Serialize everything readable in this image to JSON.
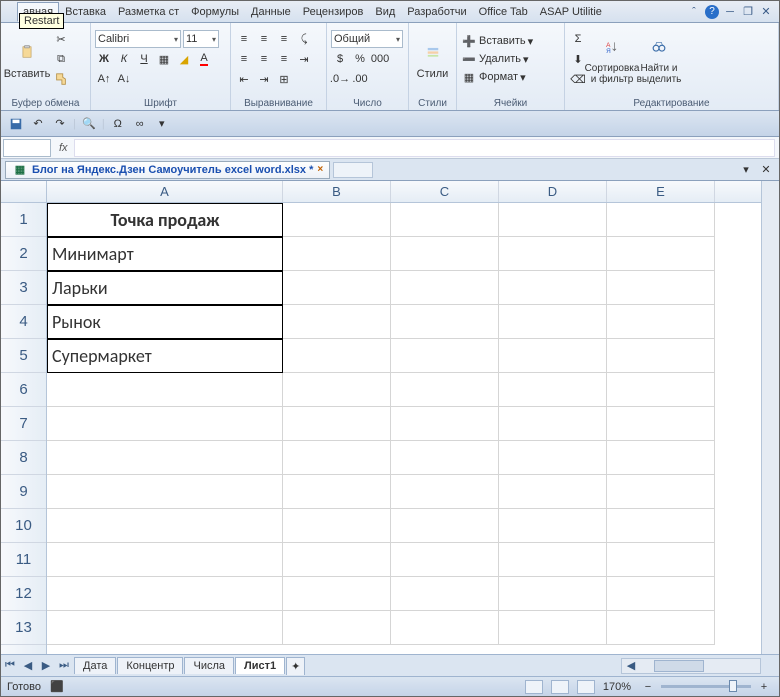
{
  "tooltip": "Restart",
  "tabs": [
    "авная",
    "Вставка",
    "Разметка ст",
    "Формулы",
    "Данные",
    "Рецензиров",
    "Вид",
    "Разработчи",
    "Office Tab",
    "ASAP Utilitie"
  ],
  "ribbon": {
    "paste": "Вставить",
    "clipboard": "Буфер обмена",
    "font": {
      "name": "Calibri",
      "size": "11",
      "group": "Шрифт"
    },
    "align": "Выравнивание",
    "number": {
      "format": "Общий",
      "group": "Число"
    },
    "styles": {
      "btn": "Стили",
      "group": "Стили"
    },
    "cells": {
      "insert": "Вставить",
      "delete": "Удалить",
      "format": "Формат",
      "group": "Ячейки"
    },
    "edit": {
      "sort": "Сортировка\nи фильтр",
      "find": "Найти и\nвыделить",
      "group": "Редактирование"
    }
  },
  "doc": {
    "title": "Блог на Яндекс.Дзен Самоучитель excel word.xlsx *"
  },
  "columns": [
    "A",
    "B",
    "C",
    "D",
    "E"
  ],
  "data": {
    "A1": "Точка продаж",
    "A2": "Минимарт",
    "A3": "Ларьки",
    "A4": "Рынок",
    "A5": "Супермаркет"
  },
  "sheets": [
    "Дата",
    "Концентр",
    "Числа",
    "Лист1"
  ],
  "status": {
    "ready": "Готово",
    "zoom": "170%"
  }
}
